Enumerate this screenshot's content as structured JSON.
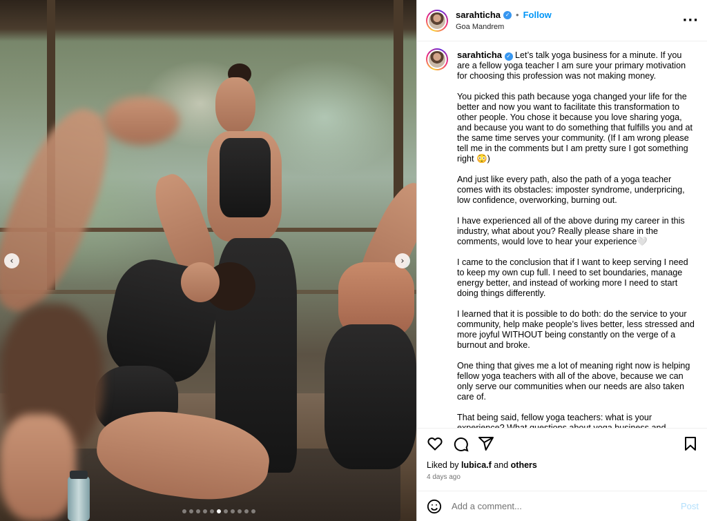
{
  "header": {
    "username": "sarahticha",
    "separator": "•",
    "follow_label": "Follow",
    "location": "Goa Mandrem",
    "more_icon": "more-horizontal-icon"
  },
  "media": {
    "slide_count": 11,
    "active_slide": 5,
    "prev_icon": "chevron-left-icon",
    "next_icon": "chevron-right-icon"
  },
  "caption": {
    "username": "sarahticha",
    "paragraphs": [
      "Let’s talk yoga business for a minute. If you are a fellow yoga teacher I am sure your primary motivation for choosing this profession was not making money.",
      "You picked this path because yoga changed your life for the better and now you want to facilitate this transformation to other people. You chose it because you love sharing yoga, and because you want to do something that fulfills you and at the same time serves your community. (If I am wrong please tell me in the comments but I am pretty sure I got something right 😳)",
      "And just like every path, also the path of a yoga teacher comes with its obstacles: imposter syndrome, underpricing, low confidence, overworking, burning out.",
      "I have experienced all of the above during my career in this industry, what about you? Really please share in the comments, would love to hear your experience🤍",
      "I came to the conclusion that if I want to keep serving I need to keep my own cup full. I need to set boundaries, manage energy better, and instead of working more I need to start doing things differently.",
      "I learned that it is possible to do both: do the service to your community, help make people’s lives better, less stressed and more joyful WITHOUT being constantly on the verge of a burnout and broke.",
      "One thing that gives me a lot of meaning right now is helping fellow yoga teachers with all of the above, because we can only serve our communities when our needs are also taken care of.",
      "That being said, fellow yoga teachers: what is your experience? What questions about yoga business and"
    ]
  },
  "actions": {
    "like_icon": "heart-icon",
    "comment_icon": "comment-icon",
    "share_icon": "share-icon",
    "save_icon": "bookmark-icon"
  },
  "likes": {
    "prefix": "Liked by",
    "user": "lubica.f",
    "connector": "and",
    "others": "others"
  },
  "date": "4 days ago",
  "comment_box": {
    "emoji_icon": "smiley-icon",
    "placeholder": "Add a comment...",
    "post_label": "Post"
  }
}
